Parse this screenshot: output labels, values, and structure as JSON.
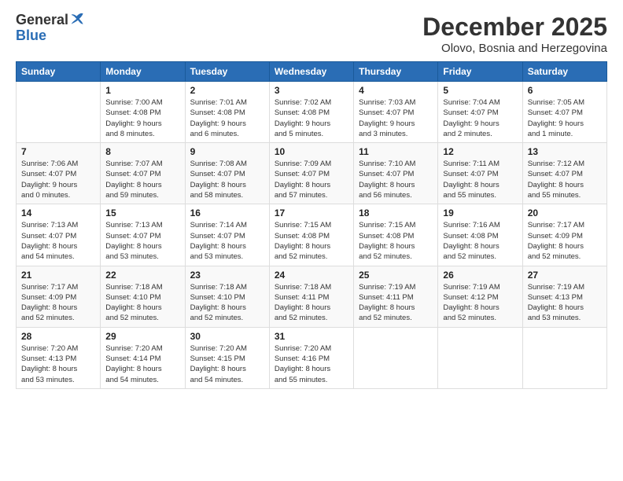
{
  "logo": {
    "line1": "General",
    "line2": "Blue"
  },
  "title": "December 2025",
  "subtitle": "Olovo, Bosnia and Herzegovina",
  "days_of_week": [
    "Sunday",
    "Monday",
    "Tuesday",
    "Wednesday",
    "Thursday",
    "Friday",
    "Saturday"
  ],
  "weeks": [
    [
      {
        "day": "",
        "info": ""
      },
      {
        "day": "1",
        "info": "Sunrise: 7:00 AM\nSunset: 4:08 PM\nDaylight: 9 hours\nand 8 minutes."
      },
      {
        "day": "2",
        "info": "Sunrise: 7:01 AM\nSunset: 4:08 PM\nDaylight: 9 hours\nand 6 minutes."
      },
      {
        "day": "3",
        "info": "Sunrise: 7:02 AM\nSunset: 4:08 PM\nDaylight: 9 hours\nand 5 minutes."
      },
      {
        "day": "4",
        "info": "Sunrise: 7:03 AM\nSunset: 4:07 PM\nDaylight: 9 hours\nand 3 minutes."
      },
      {
        "day": "5",
        "info": "Sunrise: 7:04 AM\nSunset: 4:07 PM\nDaylight: 9 hours\nand 2 minutes."
      },
      {
        "day": "6",
        "info": "Sunrise: 7:05 AM\nSunset: 4:07 PM\nDaylight: 9 hours\nand 1 minute."
      }
    ],
    [
      {
        "day": "7",
        "info": "Sunrise: 7:06 AM\nSunset: 4:07 PM\nDaylight: 9 hours\nand 0 minutes."
      },
      {
        "day": "8",
        "info": "Sunrise: 7:07 AM\nSunset: 4:07 PM\nDaylight: 8 hours\nand 59 minutes."
      },
      {
        "day": "9",
        "info": "Sunrise: 7:08 AM\nSunset: 4:07 PM\nDaylight: 8 hours\nand 58 minutes."
      },
      {
        "day": "10",
        "info": "Sunrise: 7:09 AM\nSunset: 4:07 PM\nDaylight: 8 hours\nand 57 minutes."
      },
      {
        "day": "11",
        "info": "Sunrise: 7:10 AM\nSunset: 4:07 PM\nDaylight: 8 hours\nand 56 minutes."
      },
      {
        "day": "12",
        "info": "Sunrise: 7:11 AM\nSunset: 4:07 PM\nDaylight: 8 hours\nand 55 minutes."
      },
      {
        "day": "13",
        "info": "Sunrise: 7:12 AM\nSunset: 4:07 PM\nDaylight: 8 hours\nand 55 minutes."
      }
    ],
    [
      {
        "day": "14",
        "info": "Sunrise: 7:13 AM\nSunset: 4:07 PM\nDaylight: 8 hours\nand 54 minutes."
      },
      {
        "day": "15",
        "info": "Sunrise: 7:13 AM\nSunset: 4:07 PM\nDaylight: 8 hours\nand 53 minutes."
      },
      {
        "day": "16",
        "info": "Sunrise: 7:14 AM\nSunset: 4:07 PM\nDaylight: 8 hours\nand 53 minutes."
      },
      {
        "day": "17",
        "info": "Sunrise: 7:15 AM\nSunset: 4:08 PM\nDaylight: 8 hours\nand 52 minutes."
      },
      {
        "day": "18",
        "info": "Sunrise: 7:15 AM\nSunset: 4:08 PM\nDaylight: 8 hours\nand 52 minutes."
      },
      {
        "day": "19",
        "info": "Sunrise: 7:16 AM\nSunset: 4:08 PM\nDaylight: 8 hours\nand 52 minutes."
      },
      {
        "day": "20",
        "info": "Sunrise: 7:17 AM\nSunset: 4:09 PM\nDaylight: 8 hours\nand 52 minutes."
      }
    ],
    [
      {
        "day": "21",
        "info": "Sunrise: 7:17 AM\nSunset: 4:09 PM\nDaylight: 8 hours\nand 52 minutes."
      },
      {
        "day": "22",
        "info": "Sunrise: 7:18 AM\nSunset: 4:10 PM\nDaylight: 8 hours\nand 52 minutes."
      },
      {
        "day": "23",
        "info": "Sunrise: 7:18 AM\nSunset: 4:10 PM\nDaylight: 8 hours\nand 52 minutes."
      },
      {
        "day": "24",
        "info": "Sunrise: 7:18 AM\nSunset: 4:11 PM\nDaylight: 8 hours\nand 52 minutes."
      },
      {
        "day": "25",
        "info": "Sunrise: 7:19 AM\nSunset: 4:11 PM\nDaylight: 8 hours\nand 52 minutes."
      },
      {
        "day": "26",
        "info": "Sunrise: 7:19 AM\nSunset: 4:12 PM\nDaylight: 8 hours\nand 52 minutes."
      },
      {
        "day": "27",
        "info": "Sunrise: 7:19 AM\nSunset: 4:13 PM\nDaylight: 8 hours\nand 53 minutes."
      }
    ],
    [
      {
        "day": "28",
        "info": "Sunrise: 7:20 AM\nSunset: 4:13 PM\nDaylight: 8 hours\nand 53 minutes."
      },
      {
        "day": "29",
        "info": "Sunrise: 7:20 AM\nSunset: 4:14 PM\nDaylight: 8 hours\nand 54 minutes."
      },
      {
        "day": "30",
        "info": "Sunrise: 7:20 AM\nSunset: 4:15 PM\nDaylight: 8 hours\nand 54 minutes."
      },
      {
        "day": "31",
        "info": "Sunrise: 7:20 AM\nSunset: 4:16 PM\nDaylight: 8 hours\nand 55 minutes."
      },
      {
        "day": "",
        "info": ""
      },
      {
        "day": "",
        "info": ""
      },
      {
        "day": "",
        "info": ""
      }
    ]
  ]
}
